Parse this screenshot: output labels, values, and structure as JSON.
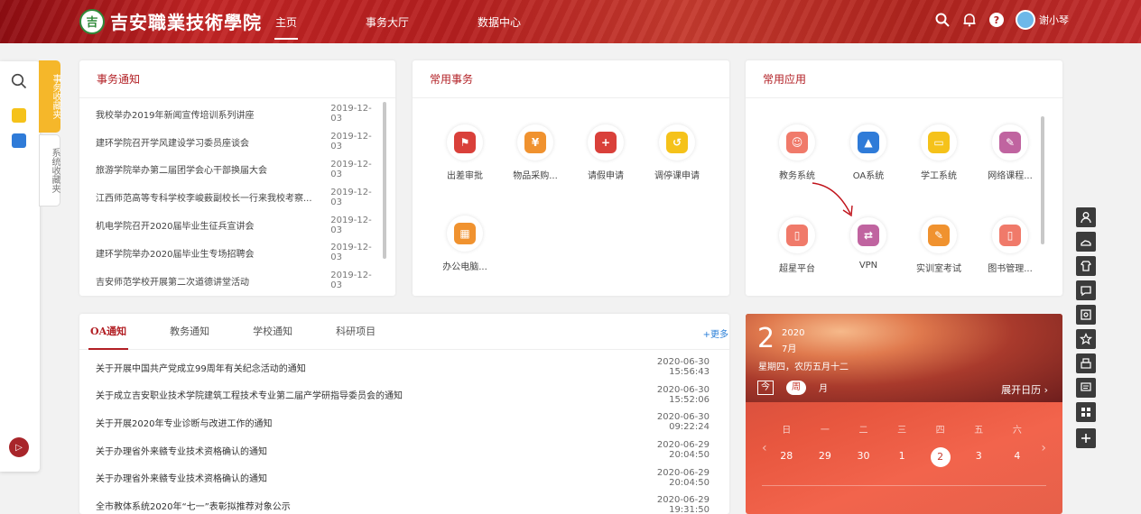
{
  "header": {
    "logo_text": "吉安職業技術學院",
    "nav": [
      "主页",
      "事务大厅",
      "数据中心"
    ],
    "username": "谢小琴",
    "help_label": "?"
  },
  "sidebar": {
    "tab_active": "事务收藏夹",
    "tab_inactive": "系统收藏夹",
    "bottom_icon_label": "▷"
  },
  "notices": {
    "title": "事务通知",
    "items": [
      {
        "title": "我校举办2019年新闻宣传培训系列讲座",
        "date": "2019-12-03"
      },
      {
        "title": "建环学院召开学风建设学习委员座谈会",
        "date": "2019-12-03"
      },
      {
        "title": "旅游学院举办第二届团学会心干部换届大会",
        "date": "2019-12-03"
      },
      {
        "title": "江西师范高等专科学校李峻薮副校长一行来我校考察...",
        "date": "2019-12-03"
      },
      {
        "title": "机电学院召开2020届毕业生征兵宣讲会",
        "date": "2019-12-03"
      },
      {
        "title": "建环学院举办2020届毕业生专场招聘会",
        "date": "2019-12-03"
      },
      {
        "title": "吉安师范学校开展第二次道德讲堂活动",
        "date": "2019-12-03"
      }
    ]
  },
  "common_tasks": {
    "title": "常用事务",
    "apps": [
      {
        "label": "出差审批",
        "color": "#d9403a",
        "glyph": "⚑"
      },
      {
        "label": "物品采购...",
        "color": "#f0922f",
        "glyph": "¥"
      },
      {
        "label": "请假申请",
        "color": "#d9403a",
        "glyph": "+"
      },
      {
        "label": "调停课申请",
        "color": "#f5c21a",
        "glyph": "↺"
      },
      {
        "label": "办公电脑...",
        "color": "#f0922f",
        "glyph": "▦"
      }
    ]
  },
  "common_apps": {
    "title": "常用应用",
    "apps": [
      {
        "label": "教务系统",
        "color": "#f07a6a",
        "glyph": "☺"
      },
      {
        "label": "OA系统",
        "color": "#2f7bd8",
        "glyph": "▲"
      },
      {
        "label": "学工系统",
        "color": "#f5c21a",
        "glyph": "▭"
      },
      {
        "label": "网络课程...",
        "color": "#c064a0",
        "glyph": "✎"
      },
      {
        "label": "超星平台",
        "color": "#f07a6a",
        "glyph": "▯"
      },
      {
        "label": "VPN",
        "color": "#c064a0",
        "glyph": "⇄"
      },
      {
        "label": "实训室考试",
        "color": "#f0922f",
        "glyph": "✎"
      },
      {
        "label": "图书管理...",
        "color": "#f07a6a",
        "glyph": "▯"
      }
    ]
  },
  "oa": {
    "tabs": [
      "OA通知",
      "教务通知",
      "学校通知",
      "科研项目"
    ],
    "more": "+更多",
    "items": [
      {
        "title": "关于开展中国共产党成立99周年有关纪念活动的通知",
        "date": "2020-06-30 15:56:43"
      },
      {
        "title": "关于成立吉安职业技术学院建筑工程技术专业第二届产学研指导委员会的通知",
        "date": "2020-06-30 15:52:06"
      },
      {
        "title": "关于开展2020年专业诊断与改进工作的通知",
        "date": "2020-06-30 09:22:24"
      },
      {
        "title": "关于办理省外来赣专业技术资格确认的通知",
        "date": "2020-06-29 20:04:50"
      },
      {
        "title": "关于办理省外来赣专业技术资格确认的通知",
        "date": "2020-06-29 20:04:50"
      },
      {
        "title": "全市教体系统2020年“七一”表彰拟推荐对象公示",
        "date": "2020-06-29 19:31:50"
      }
    ]
  },
  "calendar": {
    "day": "2",
    "year": "2020",
    "month": "7月",
    "lunar": "星期四，农历五月十二",
    "btn_today": "今",
    "btn_week": "周",
    "btn_month": "月",
    "expand": "展开日历 ›",
    "weekdays": [
      "日",
      "一",
      "二",
      "三",
      "四",
      "五",
      "六"
    ],
    "dates": [
      "28",
      "29",
      "30",
      "1",
      "2",
      "3",
      "4"
    ],
    "current": "2"
  }
}
